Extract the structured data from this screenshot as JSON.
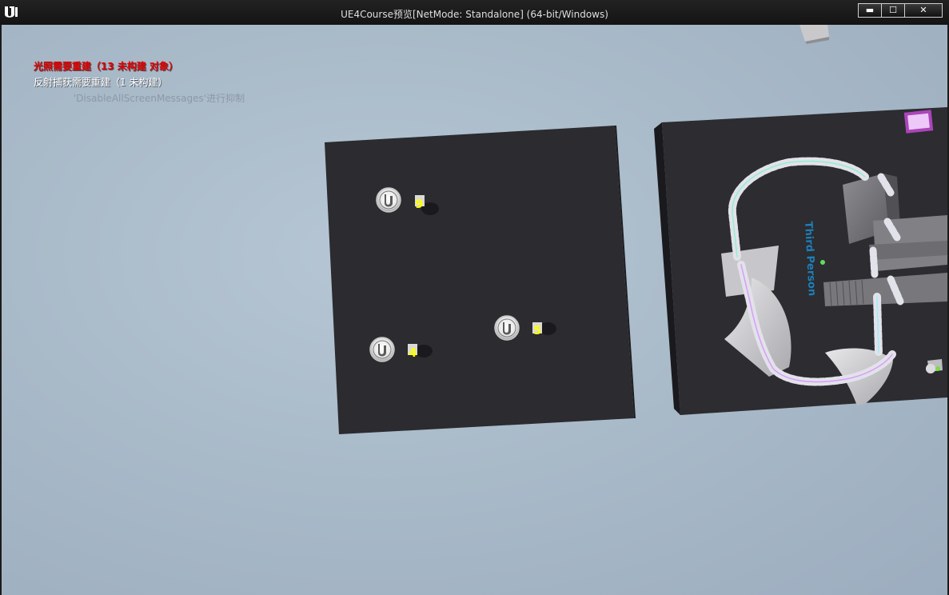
{
  "window": {
    "title": "UE4Course预览[NetMode: Standalone]  (64-bit/Windows)",
    "controls": {
      "minimize": "▬",
      "maximize": "☐",
      "close": "✕"
    }
  },
  "screen_messages": {
    "lighting": "光照需要重建（13 未构建 对象）",
    "reflection": "反射捕获需要重建（1 未构建）",
    "suppressed": "'DisableAllScreenMessages'进行抑制"
  },
  "scene": {
    "pickups": [
      {
        "number": "9"
      },
      {
        "number": "5"
      },
      {
        "number": "4"
      }
    ],
    "floor_text": "Third Person"
  },
  "colors": {
    "sky": "#aebfcd",
    "platform": "#2b2b30",
    "pickup_number": "#ffff00",
    "floor_text": "#1e7fb8",
    "error_text": "#e00000"
  }
}
